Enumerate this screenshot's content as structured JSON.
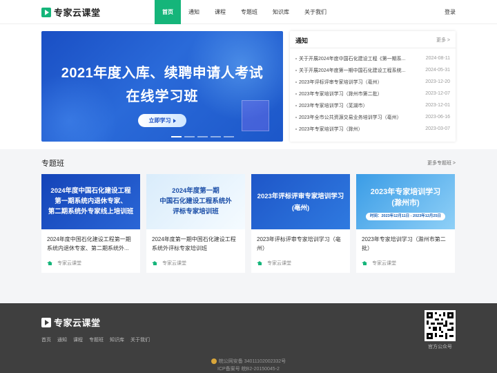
{
  "header": {
    "brand": "专家云课堂",
    "nav": [
      "首页",
      "通知",
      "课程",
      "专题班",
      "知识库",
      "关于我们"
    ],
    "login": "登录"
  },
  "banner": {
    "line1": "2021年度入库、续聘申请人考试",
    "line2": "在线学习班",
    "button": "立即学习",
    "slides": 5,
    "active_slide": 1
  },
  "notice": {
    "title": "通知",
    "more": "更多 >",
    "items": [
      {
        "text": "关于开展2024年度中国石化建设工程《第一期系...",
        "date": "2024-08-11"
      },
      {
        "text": "关于开展2024年度第一期中国石化建设工程系统...",
        "date": "2024-05-31"
      },
      {
        "text": "2023年评标评审专家培训学习（亳州）",
        "date": "2023-12-20"
      },
      {
        "text": "2023年专家培训学习（滁州市第二批）",
        "date": "2023-12-07"
      },
      {
        "text": "2023年专家培训学习（芜湖市）",
        "date": "2023-12-01"
      },
      {
        "text": "2023年全市公共资源交易业务培训学习（亳州）",
        "date": "2023-06-16"
      },
      {
        "text": "2023年专家培训学习（滁州）",
        "date": "2023-03-07"
      }
    ]
  },
  "special": {
    "title": "专题班",
    "more": "更多专题班 >",
    "cards": [
      {
        "img_lines": [
          "2024年度中国石化建设工程",
          "第一期系统内退休专家、",
          "第二期系统外专家线上培训班"
        ],
        "title": "2024年度中国石化建设工程第一期系统内退休专家、第二期系统外...",
        "source": "专家云课堂"
      },
      {
        "img_lines": [
          "2024年度第一期",
          "中国石化建设工程系统外",
          "评标专家培训班"
        ],
        "title": "2024年度第一期中国石化建设工程系统外评标专家培训班",
        "source": "专家云课堂"
      },
      {
        "img_lines": [
          "2023年评标评审专家培训学习",
          "(亳州)"
        ],
        "title": "2023年评标评审专家培训学习（亳州）",
        "source": "专家云课堂"
      },
      {
        "img_lines": [
          "2023年专家培训学习",
          "(滁州市)"
        ],
        "img_date": "时间：2023年12月11日 - 2023年12月25日",
        "title": "2023年专家培训学习（滁州市第二批）",
        "source": "专家云课堂"
      }
    ]
  },
  "footer": {
    "brand": "专家云课堂",
    "nav": [
      "首页",
      "通知",
      "课程",
      "专题班",
      "知识库",
      "关于我们"
    ],
    "qr_label": "官方公众号",
    "police": "皖公网安备 34011102002332号",
    "icp": "ICP备案号 皖B2-20150045-2"
  }
}
